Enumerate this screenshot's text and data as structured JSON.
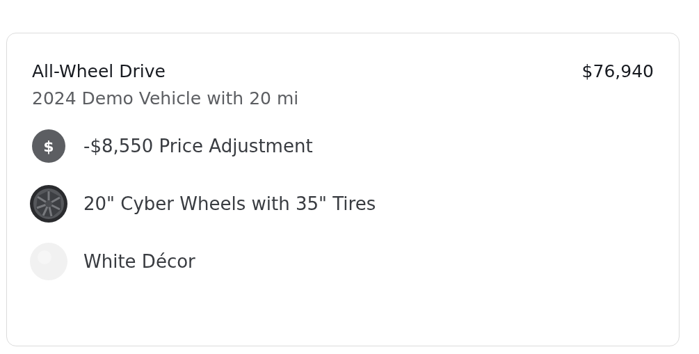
{
  "card": {
    "title": "All-Wheel Drive",
    "price": "$76,940",
    "subtitle": "2024 Demo Vehicle with 20 mi",
    "items": [
      {
        "kind": "price",
        "icon_text": "$",
        "label": "-$8,550 Price Adjustment"
      },
      {
        "kind": "wheel",
        "label": "20\" Cyber Wheels with 35\" Tires"
      },
      {
        "kind": "swatch",
        "label": "White Décor"
      }
    ]
  }
}
